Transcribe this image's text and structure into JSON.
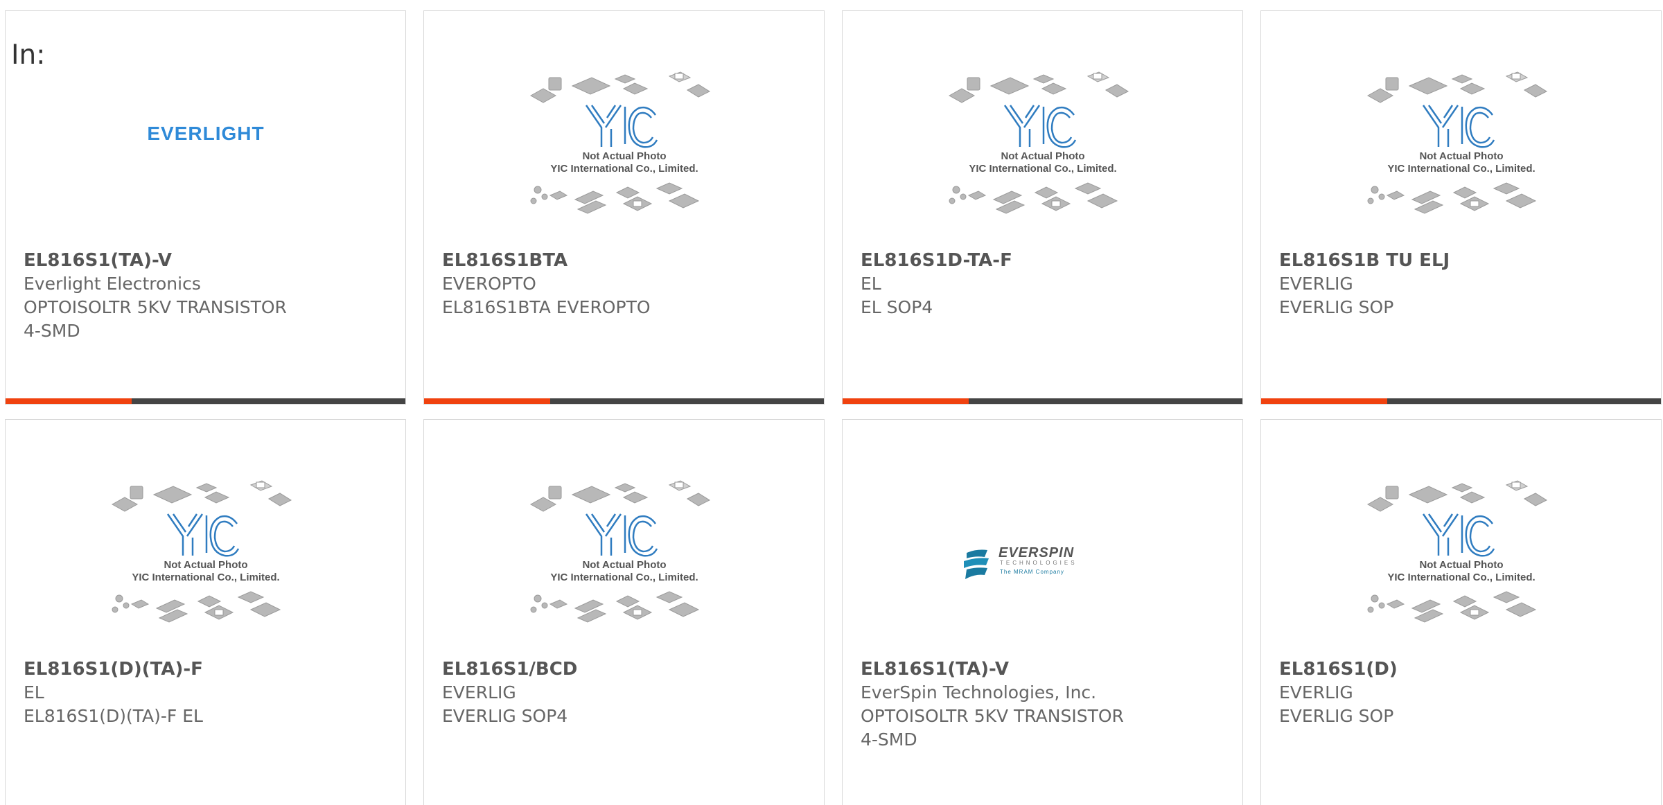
{
  "filter_label": "In:",
  "accent_color": "#f0420f",
  "bar_color": "#444444",
  "placeholder_caption": {
    "line1": "Not Actual Photo",
    "line2": "YIC International Co., Limited."
  },
  "logos": {
    "everlight": "EVERLIGHT",
    "everspin_name": "EVERSPIN",
    "everspin_sub": "TECHNOLOGIES",
    "everspin_tag": "The MRAM Company"
  },
  "products": [
    {
      "part": "EL816S1(TA)-V",
      "brand": "Everlight Electronics",
      "desc": "OPTOISOLTR 5KV TRANSISTOR",
      "extra": "4-SMD",
      "image": "everlight-logo"
    },
    {
      "part": "EL816S1BTA",
      "brand": "EVEROPTO",
      "desc": "EL816S1BTA EVEROPTO",
      "extra": "",
      "image": "yic-placeholder"
    },
    {
      "part": "EL816S1D-TA-F",
      "brand": "EL",
      "desc": "EL SOP4",
      "extra": "",
      "image": "yic-placeholder"
    },
    {
      "part": "EL816S1B TU ELJ",
      "brand": "EVERLIG",
      "desc": "EVERLIG SOP",
      "extra": "",
      "image": "yic-placeholder"
    },
    {
      "part": "EL816S1(D)(TA)-F",
      "brand": "EL",
      "desc": "EL816S1(D)(TA)-F EL",
      "extra": "",
      "image": "yic-placeholder"
    },
    {
      "part": "EL816S1/BCD",
      "brand": "EVERLIG",
      "desc": "EVERLIG SOP4",
      "extra": "",
      "image": "yic-placeholder"
    },
    {
      "part": "EL816S1(TA)-V",
      "brand": "EverSpin Technologies, Inc.",
      "desc": "OPTOISOLTR 5KV TRANSISTOR",
      "extra": "4-SMD",
      "image": "everspin-logo"
    },
    {
      "part": "EL816S1(D)",
      "brand": "EVERLIG",
      "desc": "EVERLIG SOP",
      "extra": "",
      "image": "yic-placeholder"
    }
  ]
}
